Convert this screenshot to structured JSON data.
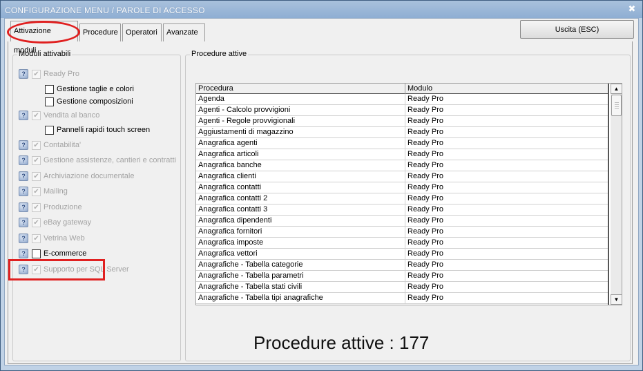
{
  "window": {
    "title": "CONFIGURAZIONE MENU / PAROLE DI ACCESSO",
    "close_glyph": "✖"
  },
  "tabs": [
    {
      "label": "Attivazione moduli",
      "active": true
    },
    {
      "label": "Procedure",
      "active": false
    },
    {
      "label": "Operatori",
      "active": false
    },
    {
      "label": "Avanzate",
      "active": false
    }
  ],
  "exit_button": {
    "label": "Uscita (ESC)"
  },
  "modules_group": {
    "title": "Moduli attivabili",
    "modules": [
      {
        "label": "Ready Pro",
        "checked": true,
        "enabled": false,
        "icon": "help-icon",
        "subs": [
          {
            "label": "Gestione taglie e colori",
            "checked": false
          },
          {
            "label": "Gestione composizioni",
            "checked": false
          }
        ]
      },
      {
        "label": "Vendita al banco",
        "checked": true,
        "enabled": false,
        "icon": "help-icon",
        "subs": [
          {
            "label": "Pannelli rapidi touch screen",
            "checked": false
          }
        ]
      },
      {
        "label": "Contabilita'",
        "checked": true,
        "enabled": false,
        "icon": "help-icon",
        "subs": []
      },
      {
        "label": "Gestione assistenze, cantieri e contratti",
        "checked": true,
        "enabled": false,
        "icon": "help-icon",
        "subs": []
      },
      {
        "label": "Archiviazione documentale",
        "checked": true,
        "enabled": false,
        "icon": "help-icon",
        "subs": []
      },
      {
        "label": "Mailing",
        "checked": true,
        "enabled": false,
        "icon": "help-icon",
        "subs": []
      },
      {
        "label": "Produzione",
        "checked": true,
        "enabled": false,
        "icon": "help-icon",
        "subs": []
      },
      {
        "label": "eBay gateway",
        "checked": true,
        "enabled": false,
        "icon": "help-icon",
        "subs": []
      },
      {
        "label": "Vetrina Web",
        "checked": true,
        "enabled": false,
        "icon": "help-icon",
        "subs": []
      },
      {
        "label": "E-commerce",
        "checked": false,
        "enabled": true,
        "icon": "help-icon",
        "subs": []
      },
      {
        "label": "Supporto per SQL Server",
        "checked": true,
        "enabled": false,
        "icon": "help-icon",
        "subs": []
      }
    ]
  },
  "procedures_group": {
    "title": "Procedure attive",
    "columns": [
      "Procedura",
      "Modulo"
    ],
    "rows": [
      [
        "Agenda",
        "Ready Pro"
      ],
      [
        "Agenti - Calcolo provvigioni",
        "Ready Pro"
      ],
      [
        "Agenti - Regole provvigionali",
        "Ready Pro"
      ],
      [
        "Aggiustamenti di magazzino",
        "Ready Pro"
      ],
      [
        "Anagrafica agenti",
        "Ready Pro"
      ],
      [
        "Anagrafica articoli",
        "Ready Pro"
      ],
      [
        "Anagrafica banche",
        "Ready Pro"
      ],
      [
        "Anagrafica clienti",
        "Ready Pro"
      ],
      [
        "Anagrafica contatti",
        "Ready Pro"
      ],
      [
        "Anagrafica contatti 2",
        "Ready Pro"
      ],
      [
        "Anagrafica contatti 3",
        "Ready Pro"
      ],
      [
        "Anagrafica dipendenti",
        "Ready Pro"
      ],
      [
        "Anagrafica fornitori",
        "Ready Pro"
      ],
      [
        "Anagrafica imposte",
        "Ready Pro"
      ],
      [
        "Anagrafica vettori",
        "Ready Pro"
      ],
      [
        "Anagrafiche - Tabella categorie",
        "Ready Pro"
      ],
      [
        "Anagrafiche - Tabella parametri",
        "Ready Pro"
      ],
      [
        "Anagrafiche - Tabella stati civili",
        "Ready Pro"
      ],
      [
        "Anagrafiche - Tabella tipi anagrafiche",
        "Ready Pro"
      ]
    ],
    "scroll_up_glyph": "▲",
    "scroll_down_glyph": "▼"
  },
  "active_count_label": "Procedure attive : 177",
  "colors": {
    "accent": "#e02020",
    "titlebar": "#8eaed3"
  }
}
